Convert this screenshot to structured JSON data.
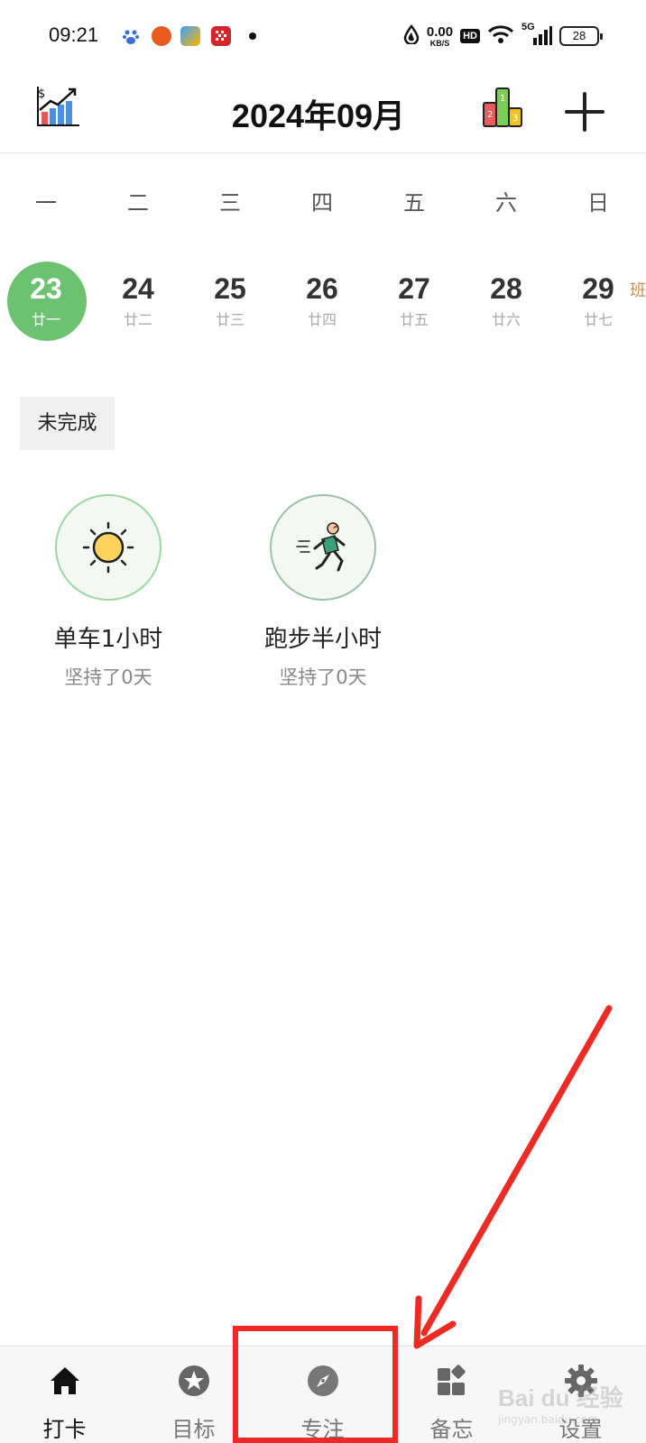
{
  "status_bar": {
    "time": "09:21",
    "net_speed_value": "0.00",
    "net_speed_unit": "KB/S",
    "hd_label": "HD",
    "network_label": "5G",
    "battery_level": "28"
  },
  "header": {
    "title": "2024年09月"
  },
  "week": {
    "weekdays": [
      "一",
      "二",
      "三",
      "四",
      "五",
      "六",
      "日"
    ],
    "dates": [
      {
        "day": "23",
        "lunar": "廿一",
        "selected": true
      },
      {
        "day": "24",
        "lunar": "廿二"
      },
      {
        "day": "25",
        "lunar": "廿三"
      },
      {
        "day": "26",
        "lunar": "廿四"
      },
      {
        "day": "27",
        "lunar": "廿五"
      },
      {
        "day": "28",
        "lunar": "廿六"
      },
      {
        "day": "29",
        "lunar": "廿七",
        "badge": "班"
      }
    ]
  },
  "filter": {
    "label": "未完成"
  },
  "habits": [
    {
      "name": "单车1小时",
      "streak": "坚持了0天",
      "icon": "sun-icon"
    },
    {
      "name": "跑步半小时",
      "streak": "坚持了0天",
      "icon": "runner-icon"
    }
  ],
  "bottom_nav": [
    {
      "label": "打卡",
      "icon": "home-icon",
      "active": true
    },
    {
      "label": "目标",
      "icon": "star-icon"
    },
    {
      "label": "专注",
      "icon": "compass-icon"
    },
    {
      "label": "备忘",
      "icon": "widgets-icon"
    },
    {
      "label": "设置",
      "icon": "gear-icon"
    }
  ],
  "colors": {
    "accent_green": "#6cc271",
    "annotation_red": "#ee2a24",
    "holiday_badge": "#d08a4a"
  },
  "watermark": {
    "brand": "Bai du 经验",
    "url": "jingyan.baidu.com"
  }
}
